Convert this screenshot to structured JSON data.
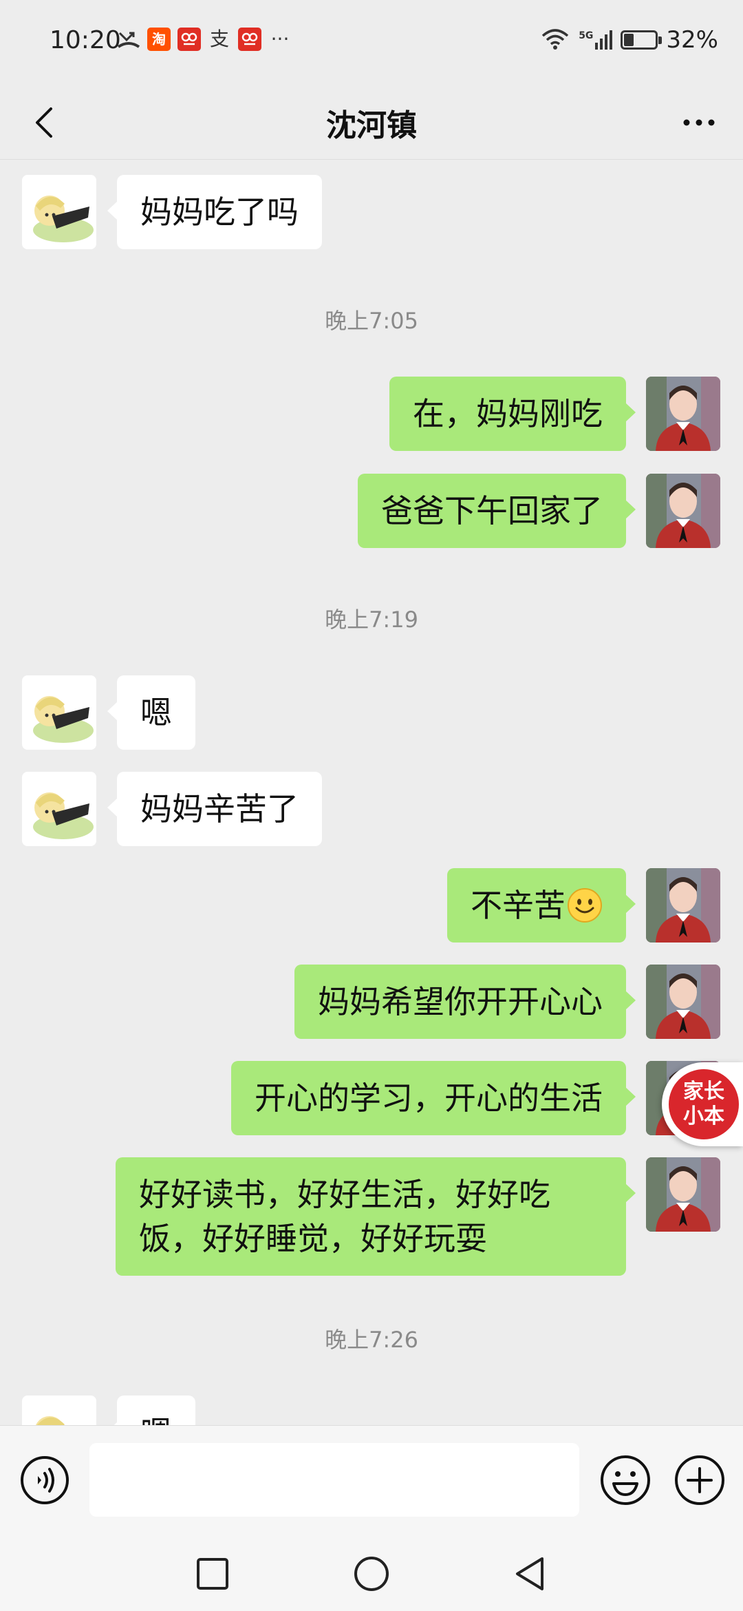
{
  "status_bar": {
    "time": "10:20",
    "battery_text": "32%",
    "battery_level": 0.32,
    "icons": [
      "missed-call-icon",
      "taobao-icon",
      "pinduoduo-icon",
      "alipay-icon",
      "pinduoduo-icon",
      "more-notifications-icon",
      "wifi-icon",
      "5g-signal-icon",
      "battery-icon"
    ],
    "taobao_text": "淘",
    "alipay_text": "支",
    "more_text": "···",
    "net_text": "5G"
  },
  "header": {
    "title": "沈河镇"
  },
  "messages": [
    {
      "side": "left",
      "text": "妈妈吃了吗"
    },
    {
      "type": "time",
      "text": "晚上7:05"
    },
    {
      "side": "right",
      "text": "在，妈妈刚吃"
    },
    {
      "side": "right",
      "text": "爸爸下午回家了"
    },
    {
      "type": "time",
      "text": "晚上7:19"
    },
    {
      "side": "left",
      "text": "嗯"
    },
    {
      "side": "left",
      "text": "妈妈辛苦了"
    },
    {
      "side": "right",
      "text": "不辛苦",
      "emoji": "smile-emoji"
    },
    {
      "side": "right",
      "text": "妈妈希望你开开心心"
    },
    {
      "side": "right",
      "text": "开心的学习，开心的生活"
    },
    {
      "side": "right",
      "text": "好好读书，好好生活，好好吃饭，好好睡觉，好好玩耍"
    },
    {
      "type": "time",
      "text": "晚上7:26"
    },
    {
      "side": "left",
      "text": "嗯"
    }
  ],
  "floating_badge": {
    "line1": "家长",
    "line2": "小本"
  },
  "input_bar": {
    "value": "",
    "placeholder": ""
  },
  "colors": {
    "background": "#ededed",
    "bubble_sent": "#a9e97a",
    "bubble_received": "#ffffff",
    "timestamp": "#8a8a8a",
    "badge": "#d9262c"
  }
}
